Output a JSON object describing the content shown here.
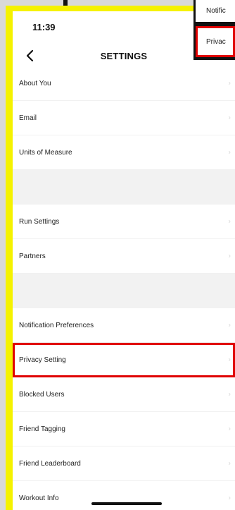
{
  "status": {
    "time": "11:39"
  },
  "header": {
    "title": "SETTINGS"
  },
  "settings": {
    "groups": [
      [
        "About You",
        "Email",
        "Units of Measure"
      ],
      [
        "Run Settings",
        "Partners"
      ],
      [
        "Notification Preferences",
        "Privacy Setting",
        "Blocked Users",
        "Friend Tagging",
        "Friend Leaderboard",
        "Workout Info"
      ]
    ],
    "highlighted": "Privacy Setting"
  },
  "popup": {
    "items": [
      "Notific",
      "Privac"
    ],
    "highlighted": "Privac"
  },
  "colors": {
    "frame": "#f5f200",
    "highlight": "#e00000",
    "spacer": "#f2f2f2"
  }
}
